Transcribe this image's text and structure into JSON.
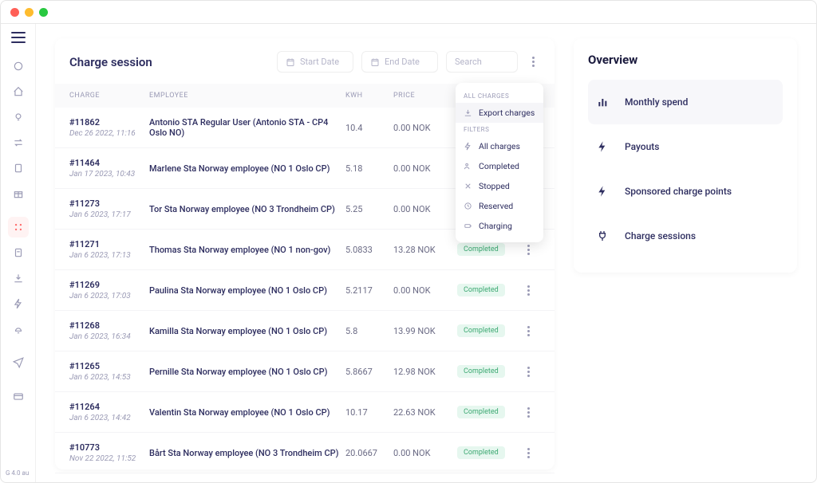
{
  "page": {
    "title": "Charge session",
    "start_placeholder": "Start Date",
    "end_placeholder": "End Date",
    "search_placeholder": "Search"
  },
  "columns": {
    "charge": "CHARGE",
    "employee": "EMPLOYEE",
    "kwh": "KWH",
    "price": "PRICE"
  },
  "dropdown": {
    "all_charges_label": "ALL CHARGES",
    "export": "Export charges",
    "filters_label": "FILTERS",
    "all": "All charges",
    "completed": "Completed",
    "stopped": "Stopped",
    "reserved": "Reserved",
    "charging": "Charging"
  },
  "rows": [
    {
      "id": "#11862",
      "date": "Dec 26 2022, 11:16",
      "employee": "Antonio STA Regular User (Antonio STA - CP4 Oslo NO)",
      "kwh": "10.4",
      "price": "0.00 NOK",
      "status": ""
    },
    {
      "id": "#11464",
      "date": "Jan 17 2023, 10:43",
      "employee": "Marlene Sta Norway employee (NO 1 Oslo CP)",
      "kwh": "5.18",
      "price": "0.00 NOK",
      "status": ""
    },
    {
      "id": "#11273",
      "date": "Jan 6 2023, 17:17",
      "employee": "Tor Sta Norway employee (NO 3 Trondheim CP)",
      "kwh": "5.25",
      "price": "0.00 NOK",
      "status": ""
    },
    {
      "id": "#11271",
      "date": "Jan 6 2023, 17:13",
      "employee": "Thomas Sta Norway employee (NO 1 non-gov)",
      "kwh": "5.0833",
      "price": "13.28 NOK",
      "status": "Completed"
    },
    {
      "id": "#11269",
      "date": "Jan 6 2023, 17:03",
      "employee": "Paulina Sta Norway employee (NO 1 Oslo CP)",
      "kwh": "5.2117",
      "price": "0.00 NOK",
      "status": "Completed"
    },
    {
      "id": "#11268",
      "date": "Jan 6 2023, 16:34",
      "employee": "Kamilla Sta Norway employee (NO 1 Oslo CP)",
      "kwh": "5.8",
      "price": "13.99 NOK",
      "status": "Completed"
    },
    {
      "id": "#11265",
      "date": "Jan 6 2023, 14:53",
      "employee": "Pernille Sta Norway employee (NO 1 Oslo CP)",
      "kwh": "5.8667",
      "price": "12.98 NOK",
      "status": "Completed"
    },
    {
      "id": "#11264",
      "date": "Jan 6 2023, 14:42",
      "employee": "Valentin Sta Norway employee (NO 1 Oslo CP)",
      "kwh": "10.17",
      "price": "22.63 NOK",
      "status": "Completed"
    },
    {
      "id": "#10773",
      "date": "Nov 22 2022, 11:52",
      "employee": "Bårt Sta Norway employee (NO 3 Trondheim CP)",
      "kwh": "20.0667",
      "price": "0.00 NOK",
      "status": "Completed"
    }
  ],
  "overview": {
    "title": "Overview",
    "items": [
      {
        "label": "Monthly spend"
      },
      {
        "label": "Payouts"
      },
      {
        "label": "Sponsored charge points"
      },
      {
        "label": "Charge sessions"
      }
    ]
  },
  "sidebar_footer": "G\n4.0\nau"
}
